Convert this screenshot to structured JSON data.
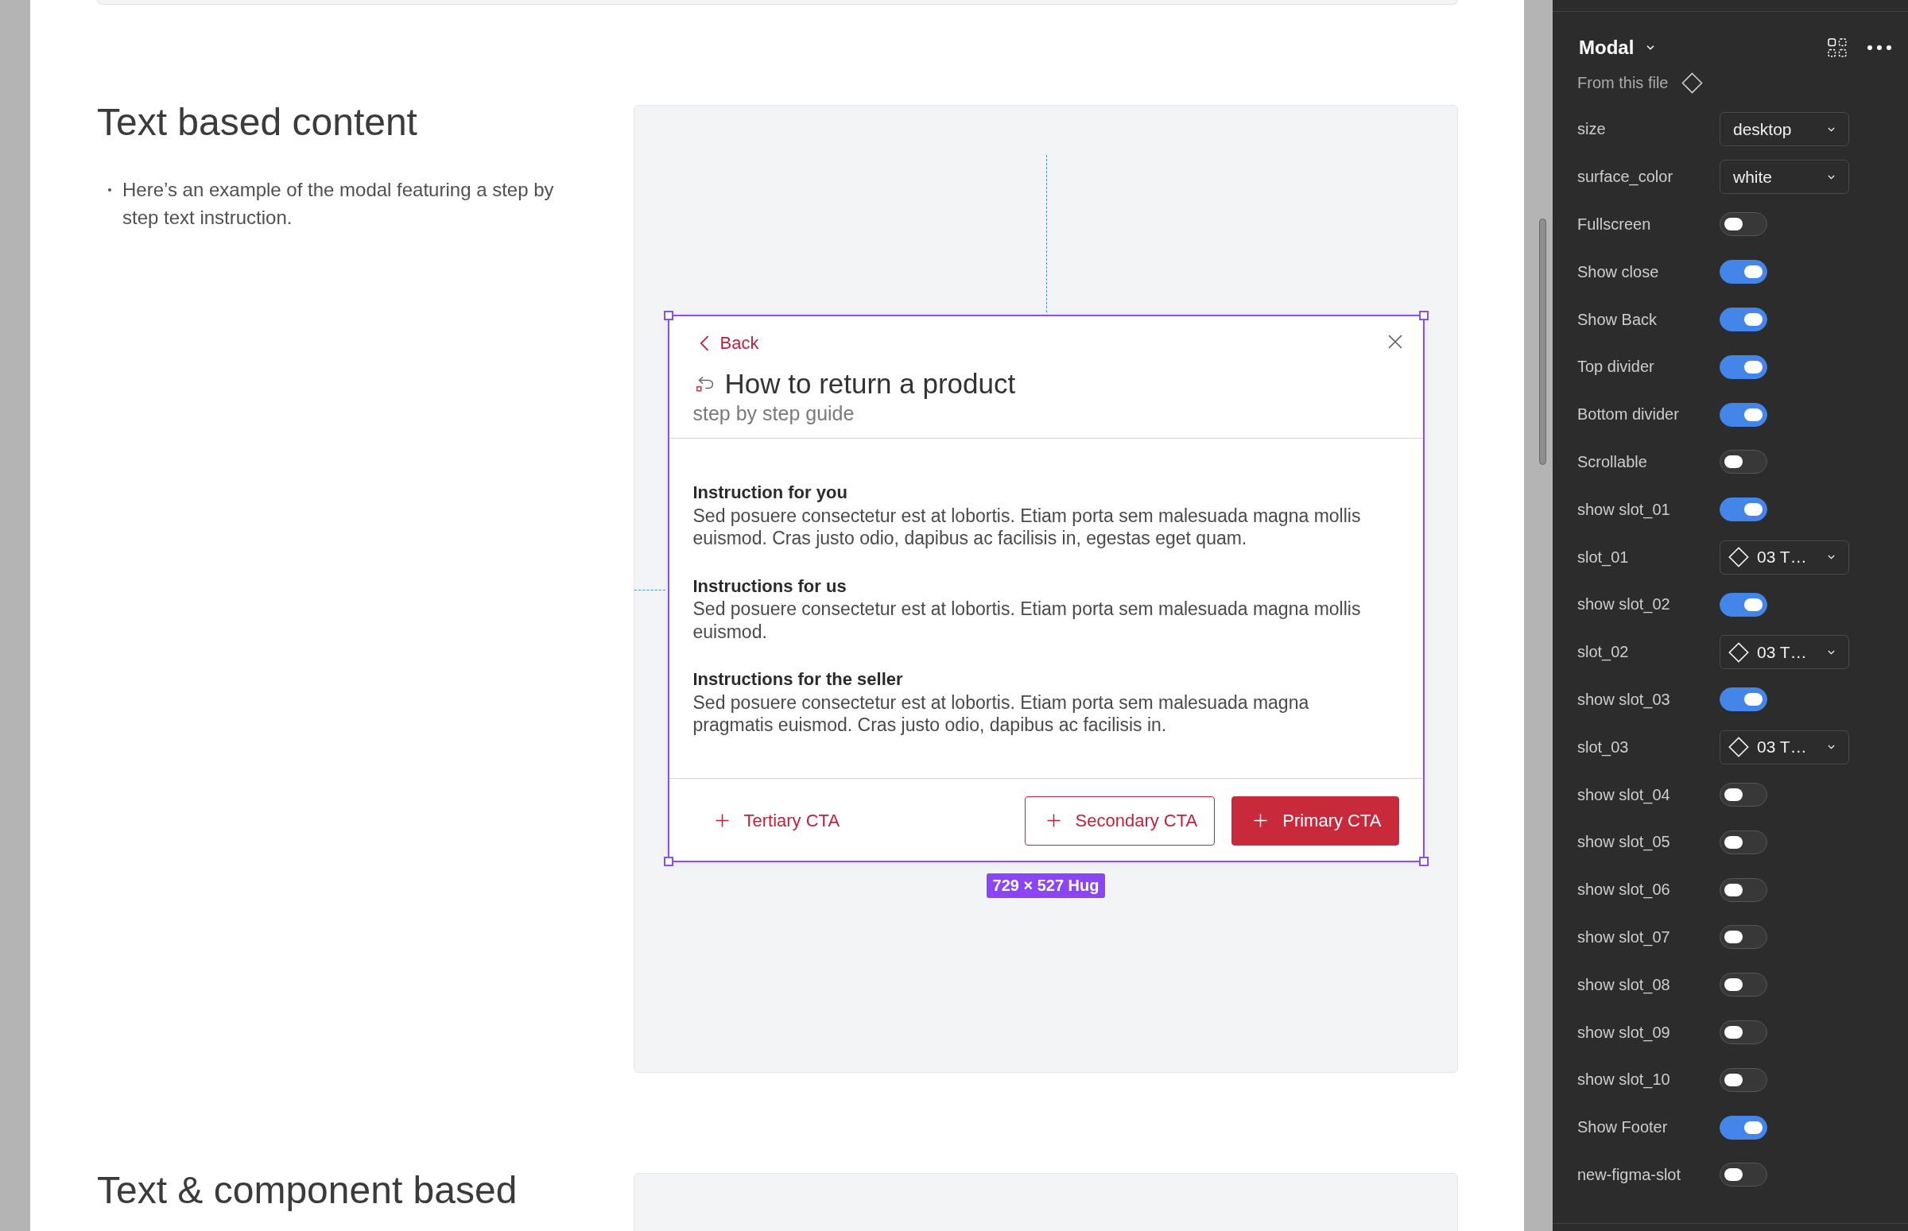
{
  "canvas": {
    "sections": [
      {
        "heading": "Text based content",
        "bullets": [
          "Here’s an example of the modal featuring a step by step text instruction."
        ],
        "preview": {
          "modal": {
            "selected": true,
            "back_label": "Back",
            "title": "How to return a product",
            "subtitle": "step by step guide",
            "sections": [
              {
                "title": "Instruction for you",
                "text": "Sed posuere consectetur est at lobortis. Etiam porta sem malesuada magna mollis euismod. Cras justo odio, dapibus ac facilisis in, egestas eget quam."
              },
              {
                "title": "Instructions for us",
                "text": "Sed posuere consectetur est at lobortis. Etiam porta sem malesuada magna mollis euismod."
              },
              {
                "title": "Instructions for the seller",
                "text": "Sed posuere consectetur est at lobortis. Etiam porta sem malesuada magna pragmatis euismod. Cras justo odio, dapibus ac facilisis in."
              }
            ],
            "footer_buttons": [
              {
                "kind": "tertiary",
                "label": "Tertiary CTA"
              },
              {
                "kind": "secondary",
                "label": "Secondary CTA"
              },
              {
                "kind": "primary",
                "label": "Primary CTA"
              }
            ]
          },
          "size_badge": "729 × 527 Hug"
        }
      },
      {
        "heading": "Text & component based"
      }
    ]
  },
  "properties_panel": {
    "title": "Modal",
    "source": "From this file",
    "properties": [
      {
        "kind": "dropdown",
        "label": "size",
        "value": "desktop"
      },
      {
        "kind": "dropdown",
        "label": "surface_color",
        "value": "white"
      },
      {
        "kind": "toggle",
        "label": "Fullscreen",
        "on": false
      },
      {
        "kind": "toggle",
        "label": "Show close",
        "on": true
      },
      {
        "kind": "toggle",
        "label": "Show Back",
        "on": true
      },
      {
        "kind": "toggle",
        "label": "Top divider",
        "on": true
      },
      {
        "kind": "toggle",
        "label": "Bottom divider",
        "on": true
      },
      {
        "kind": "toggle",
        "label": "Scrollable",
        "on": false
      },
      {
        "kind": "toggle",
        "label": "show slot_01",
        "on": true
      },
      {
        "kind": "instance",
        "label": "slot_01",
        "value": "03 T…"
      },
      {
        "kind": "toggle",
        "label": "show slot_02",
        "on": true
      },
      {
        "kind": "instance",
        "label": "slot_02",
        "value": "03 T…"
      },
      {
        "kind": "toggle",
        "label": "show slot_03",
        "on": true
      },
      {
        "kind": "instance",
        "label": "slot_03",
        "value": "03 T…"
      },
      {
        "kind": "toggle",
        "label": "show slot_04",
        "on": false
      },
      {
        "kind": "toggle",
        "label": "show slot_05",
        "on": false
      },
      {
        "kind": "toggle",
        "label": "show slot_06",
        "on": false
      },
      {
        "kind": "toggle",
        "label": "show slot_07",
        "on": false
      },
      {
        "kind": "toggle",
        "label": "show slot_08",
        "on": false
      },
      {
        "kind": "toggle",
        "label": "show slot_09",
        "on": false
      },
      {
        "kind": "toggle",
        "label": "show slot_10",
        "on": false
      },
      {
        "kind": "toggle",
        "label": "Show Footer",
        "on": true
      },
      {
        "kind": "toggle",
        "label": "new-figma-slot",
        "on": false
      }
    ]
  }
}
